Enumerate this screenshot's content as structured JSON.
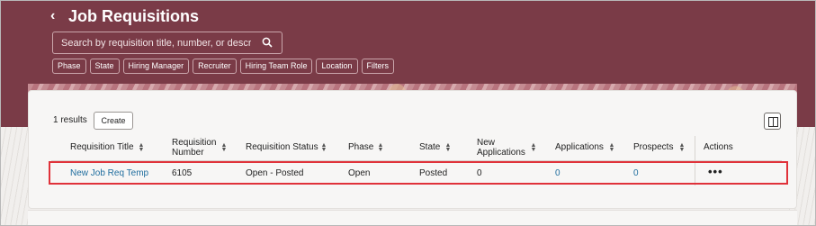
{
  "header": {
    "title": "Job Requisitions",
    "search_placeholder": "Search by requisition title, number, or description",
    "filter_chips": [
      "Phase",
      "State",
      "Hiring Manager",
      "Recruiter",
      "Hiring Team Role",
      "Location",
      "Filters"
    ]
  },
  "toolbar": {
    "results_text": "1 results",
    "create_label": "Create"
  },
  "table": {
    "columns": [
      "Requisition Title",
      "Requisition\nNumber",
      "Requisition Status",
      "Phase",
      "State",
      "New\nApplications",
      "Applications",
      "Prospects",
      "Actions"
    ],
    "rows": [
      {
        "title": "New Job Req Temp",
        "number": "6105",
        "status": "Open - Posted",
        "phase": "Open",
        "state": "Posted",
        "new_applications": "0",
        "applications": "0",
        "prospects": "0",
        "actions": "•••"
      }
    ]
  },
  "colors": {
    "header_bg": "#7a3b47",
    "link": "#1f6d9e",
    "highlight": "#e0323a"
  }
}
